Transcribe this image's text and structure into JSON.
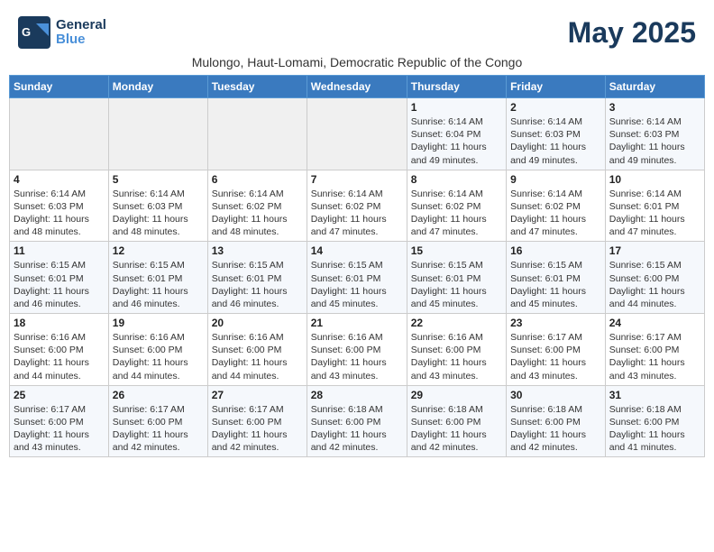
{
  "header": {
    "logo_line1": "General",
    "logo_line2": "Blue",
    "month_title": "May 2025",
    "subtitle": "Mulongo, Haut-Lomami, Democratic Republic of the Congo"
  },
  "weekdays": [
    "Sunday",
    "Monday",
    "Tuesday",
    "Wednesday",
    "Thursday",
    "Friday",
    "Saturday"
  ],
  "weeks": [
    [
      {
        "day": "",
        "info": ""
      },
      {
        "day": "",
        "info": ""
      },
      {
        "day": "",
        "info": ""
      },
      {
        "day": "",
        "info": ""
      },
      {
        "day": "1",
        "info": "Sunrise: 6:14 AM\nSunset: 6:04 PM\nDaylight: 11 hours\nand 49 minutes."
      },
      {
        "day": "2",
        "info": "Sunrise: 6:14 AM\nSunset: 6:03 PM\nDaylight: 11 hours\nand 49 minutes."
      },
      {
        "day": "3",
        "info": "Sunrise: 6:14 AM\nSunset: 6:03 PM\nDaylight: 11 hours\nand 49 minutes."
      }
    ],
    [
      {
        "day": "4",
        "info": "Sunrise: 6:14 AM\nSunset: 6:03 PM\nDaylight: 11 hours\nand 48 minutes."
      },
      {
        "day": "5",
        "info": "Sunrise: 6:14 AM\nSunset: 6:03 PM\nDaylight: 11 hours\nand 48 minutes."
      },
      {
        "day": "6",
        "info": "Sunrise: 6:14 AM\nSunset: 6:02 PM\nDaylight: 11 hours\nand 48 minutes."
      },
      {
        "day": "7",
        "info": "Sunrise: 6:14 AM\nSunset: 6:02 PM\nDaylight: 11 hours\nand 47 minutes."
      },
      {
        "day": "8",
        "info": "Sunrise: 6:14 AM\nSunset: 6:02 PM\nDaylight: 11 hours\nand 47 minutes."
      },
      {
        "day": "9",
        "info": "Sunrise: 6:14 AM\nSunset: 6:02 PM\nDaylight: 11 hours\nand 47 minutes."
      },
      {
        "day": "10",
        "info": "Sunrise: 6:14 AM\nSunset: 6:01 PM\nDaylight: 11 hours\nand 47 minutes."
      }
    ],
    [
      {
        "day": "11",
        "info": "Sunrise: 6:15 AM\nSunset: 6:01 PM\nDaylight: 11 hours\nand 46 minutes."
      },
      {
        "day": "12",
        "info": "Sunrise: 6:15 AM\nSunset: 6:01 PM\nDaylight: 11 hours\nand 46 minutes."
      },
      {
        "day": "13",
        "info": "Sunrise: 6:15 AM\nSunset: 6:01 PM\nDaylight: 11 hours\nand 46 minutes."
      },
      {
        "day": "14",
        "info": "Sunrise: 6:15 AM\nSunset: 6:01 PM\nDaylight: 11 hours\nand 45 minutes."
      },
      {
        "day": "15",
        "info": "Sunrise: 6:15 AM\nSunset: 6:01 PM\nDaylight: 11 hours\nand 45 minutes."
      },
      {
        "day": "16",
        "info": "Sunrise: 6:15 AM\nSunset: 6:01 PM\nDaylight: 11 hours\nand 45 minutes."
      },
      {
        "day": "17",
        "info": "Sunrise: 6:15 AM\nSunset: 6:00 PM\nDaylight: 11 hours\nand 44 minutes."
      }
    ],
    [
      {
        "day": "18",
        "info": "Sunrise: 6:16 AM\nSunset: 6:00 PM\nDaylight: 11 hours\nand 44 minutes."
      },
      {
        "day": "19",
        "info": "Sunrise: 6:16 AM\nSunset: 6:00 PM\nDaylight: 11 hours\nand 44 minutes."
      },
      {
        "day": "20",
        "info": "Sunrise: 6:16 AM\nSunset: 6:00 PM\nDaylight: 11 hours\nand 44 minutes."
      },
      {
        "day": "21",
        "info": "Sunrise: 6:16 AM\nSunset: 6:00 PM\nDaylight: 11 hours\nand 43 minutes."
      },
      {
        "day": "22",
        "info": "Sunrise: 6:16 AM\nSunset: 6:00 PM\nDaylight: 11 hours\nand 43 minutes."
      },
      {
        "day": "23",
        "info": "Sunrise: 6:17 AM\nSunset: 6:00 PM\nDaylight: 11 hours\nand 43 minutes."
      },
      {
        "day": "24",
        "info": "Sunrise: 6:17 AM\nSunset: 6:00 PM\nDaylight: 11 hours\nand 43 minutes."
      }
    ],
    [
      {
        "day": "25",
        "info": "Sunrise: 6:17 AM\nSunset: 6:00 PM\nDaylight: 11 hours\nand 43 minutes."
      },
      {
        "day": "26",
        "info": "Sunrise: 6:17 AM\nSunset: 6:00 PM\nDaylight: 11 hours\nand 42 minutes."
      },
      {
        "day": "27",
        "info": "Sunrise: 6:17 AM\nSunset: 6:00 PM\nDaylight: 11 hours\nand 42 minutes."
      },
      {
        "day": "28",
        "info": "Sunrise: 6:18 AM\nSunset: 6:00 PM\nDaylight: 11 hours\nand 42 minutes."
      },
      {
        "day": "29",
        "info": "Sunrise: 6:18 AM\nSunset: 6:00 PM\nDaylight: 11 hours\nand 42 minutes."
      },
      {
        "day": "30",
        "info": "Sunrise: 6:18 AM\nSunset: 6:00 PM\nDaylight: 11 hours\nand 42 minutes."
      },
      {
        "day": "31",
        "info": "Sunrise: 6:18 AM\nSunset: 6:00 PM\nDaylight: 11 hours\nand 41 minutes."
      }
    ]
  ]
}
